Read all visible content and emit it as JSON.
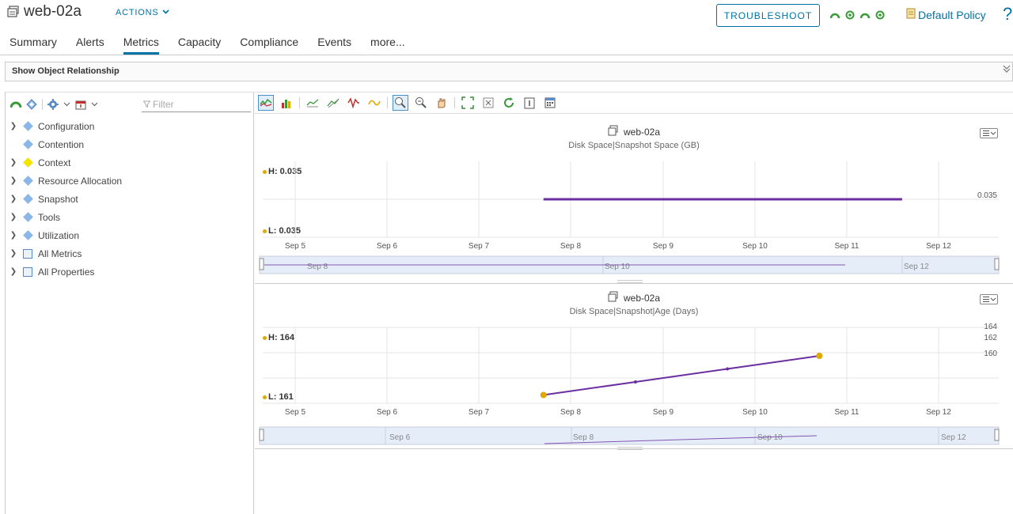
{
  "header": {
    "title": "web-02a",
    "actions_label": "ACTIONS",
    "troubleshoot_label": "TROUBLESHOOT",
    "policy_label": "Default Policy",
    "help_label": "?"
  },
  "tabs": [
    {
      "label": "Summary"
    },
    {
      "label": "Alerts"
    },
    {
      "label": "Metrics",
      "active": true
    },
    {
      "label": "Capacity"
    },
    {
      "label": "Compliance"
    },
    {
      "label": "Events"
    },
    {
      "label": "more..."
    }
  ],
  "relationship": {
    "label": "Show Object Relationship"
  },
  "left": {
    "filter_placeholder": "Filter",
    "tree": [
      {
        "label": "Configuration",
        "expandable": true,
        "icon": "diamond-blue"
      },
      {
        "label": "Contention",
        "expandable": false,
        "icon": "diamond-blue"
      },
      {
        "label": "Context",
        "expandable": true,
        "icon": "diamond-yellow"
      },
      {
        "label": "Resource Allocation",
        "expandable": true,
        "icon": "diamond-blue"
      },
      {
        "label": "Snapshot",
        "expandable": true,
        "icon": "diamond-blue"
      },
      {
        "label": "Tools",
        "expandable": true,
        "icon": "diamond-blue"
      },
      {
        "label": "Utilization",
        "expandable": true,
        "icon": "diamond-blue"
      },
      {
        "label": "All Metrics",
        "expandable": true,
        "icon": "group-icon"
      },
      {
        "label": "All Properties",
        "expandable": true,
        "icon": "group-icon"
      }
    ]
  },
  "colors": {
    "accent": "#0072a3",
    "series": "#6a2fa0",
    "marker": "#e0a800",
    "navigator_bg": "#e4edf8"
  },
  "charts": [
    {
      "object": "web-02a",
      "metric": "Disk Space|Snapshot Space (GB)",
      "high": "H: 0.035",
      "low": "L: 0.035",
      "y_labels": [
        "0.035"
      ],
      "x_labels": [
        "Sep 5",
        "Sep 6",
        "Sep 7",
        "Sep 8",
        "Sep 9",
        "Sep 10",
        "Sep 11",
        "Sep 12"
      ],
      "nav_labels": [
        "Sep 8",
        "Sep 10",
        "Sep 12"
      ]
    },
    {
      "object": "web-02a",
      "metric": "Disk Space|Snapshot|Age (Days)",
      "high": "H: 164",
      "low": "L: 161",
      "y_labels": [
        "164",
        "162",
        "160"
      ],
      "x_labels": [
        "Sep 5",
        "Sep 6",
        "Sep 7",
        "Sep 8",
        "Sep 9",
        "Sep 10",
        "Sep 11",
        "Sep 12"
      ],
      "nav_labels": [
        "Sep 6",
        "Sep 8",
        "Sep 10",
        "Sep 12"
      ]
    }
  ],
  "chart_data": [
    {
      "type": "line",
      "title": "Disk Space|Snapshot Space (GB)",
      "x_categories": [
        "Sep 5",
        "Sep 6",
        "Sep 7",
        "Sep 8",
        "Sep 9",
        "Sep 10",
        "Sep 11",
        "Sep 12"
      ],
      "series": [
        {
          "x": [
            "Sep 7.7",
            "Sep 11.6"
          ],
          "y": [
            0.035,
            0.035
          ]
        }
      ],
      "high": 0.035,
      "low": 0.035,
      "ylim": [
        0.034,
        0.036
      ],
      "grid": true
    },
    {
      "type": "line",
      "title": "Disk Space|Snapshot|Age (Days)",
      "x_categories": [
        "Sep 5",
        "Sep 6",
        "Sep 7",
        "Sep 8",
        "Sep 9",
        "Sep 10",
        "Sep 11",
        "Sep 12"
      ],
      "series": [
        {
          "x": [
            "Sep 7.7",
            "Sep 8.7",
            "Sep 9.7",
            "Sep 10.7"
          ],
          "y": [
            161,
            162,
            163,
            164
          ]
        }
      ],
      "high": 164,
      "low": 161,
      "ylim": [
        160,
        164
      ],
      "grid": true
    }
  ]
}
